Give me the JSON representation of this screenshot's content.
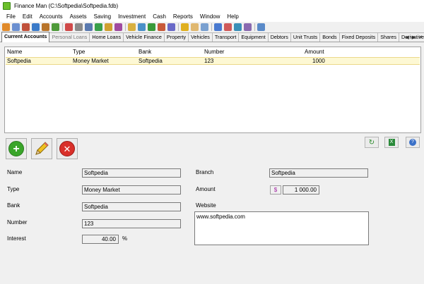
{
  "window": {
    "title": "Finance Man (C:\\Softpedia\\Softpedia.fdb)"
  },
  "menu": [
    "File",
    "Edit",
    "Accounts",
    "Assets",
    "Saving",
    "Investment",
    "Cash",
    "Reports",
    "Window",
    "Help"
  ],
  "tabs": [
    "Current Accounts",
    "Personal Loans",
    "Home Loans",
    "Vehicle Finance",
    "Property",
    "Vehicles",
    "Transport",
    "Equipment",
    "Debtors",
    "Unit Trusts",
    "Bonds",
    "Fixed Deposits",
    "Shares",
    "Derivatives"
  ],
  "list": {
    "columns": [
      "Name",
      "Type",
      "Bank",
      "Number",
      "Amount"
    ],
    "rows": [
      {
        "name": "Softpedia",
        "type": "Money Market",
        "bank": "Softpedia",
        "number": "123",
        "amount": "1000"
      }
    ]
  },
  "form": {
    "name_label": "Name",
    "name_value": "Softpedia",
    "type_label": "Type",
    "type_value": "Money Market",
    "bank_label": "Bank",
    "bank_value": "Softpedia",
    "number_label": "Number",
    "number_value": "123",
    "interest_label": "Interest",
    "interest_value": "40.00",
    "interest_unit": "%",
    "branch_label": "Branch",
    "branch_value": "Softpedia",
    "amount_label": "Amount",
    "amount_currency": "$",
    "amount_value": "1 000.00",
    "website_label": "Website",
    "website_value": "www.softpedia.com"
  },
  "icons": {
    "add": "plus-icon",
    "edit": "pencil-icon",
    "delete": "x-icon",
    "refresh": "refresh-icon",
    "export": "excel-icon",
    "help": "help-icon"
  },
  "colors": {
    "row_highlight": "#fdf8d4",
    "add": "#3aa52a",
    "delete": "#d9302a",
    "currency": "#a020a0"
  }
}
